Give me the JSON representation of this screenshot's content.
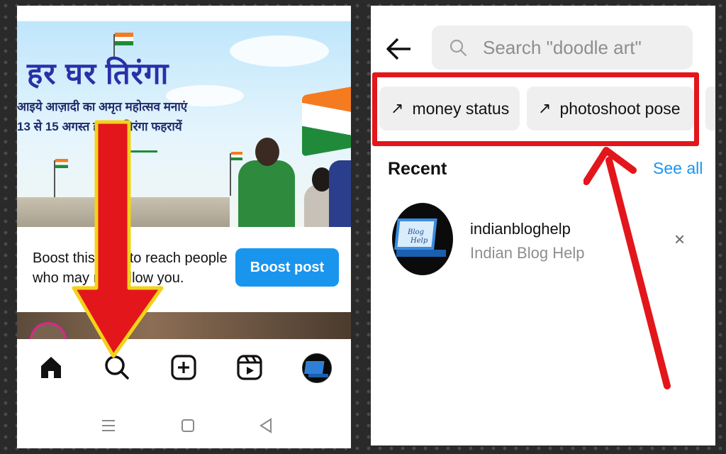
{
  "left": {
    "banner": {
      "title": "हर घर तिरंगा",
      "line1": "आइये आज़ादी का अमृत महोत्सव मनाएं",
      "line2": "13 से 15 अगस्त हर घर तिरंगा फहरायें"
    },
    "boost": {
      "text": "Boost this post to reach people who may not follow you.",
      "button_label": "Boost post"
    },
    "bottom_nav": [
      "home-icon",
      "search-icon",
      "create-icon",
      "reels-icon",
      "profile-avatar"
    ],
    "system_nav": [
      "menu-icon",
      "home-square-icon",
      "back-triangle-icon"
    ],
    "colors": {
      "accent": "#1a95ee",
      "annotation_red": "#e3161b",
      "annotation_outline": "#f3d21a"
    }
  },
  "right": {
    "search": {
      "placeholder": "Search \"doodle art\""
    },
    "suggestions": [
      {
        "arrow": "↗",
        "label": "money status"
      },
      {
        "arrow": "↗",
        "label": "photoshoot pose"
      }
    ],
    "recent": {
      "heading": "Recent",
      "see_all": "See all",
      "items": [
        {
          "username": "indianbloghelp",
          "full_name": "Indian Blog Help",
          "remove": "×"
        }
      ]
    }
  }
}
